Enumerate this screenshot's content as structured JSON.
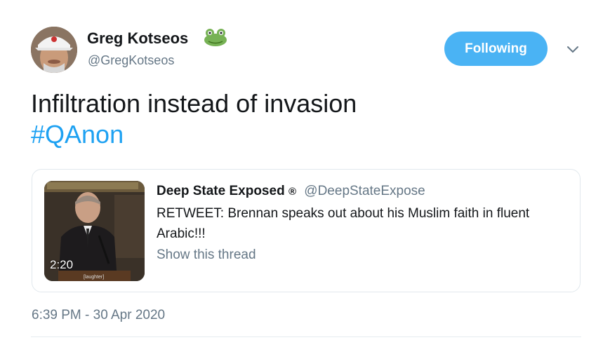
{
  "author": {
    "name": "Greg Kotseos",
    "handle": "@GregKotseos",
    "emoji_icon": "frog-icon"
  },
  "follow_button": {
    "label": "Following",
    "color": "#4ab3f4"
  },
  "menu": {
    "icon": "chevron-down-icon"
  },
  "tweet": {
    "text": "Infiltration instead of invasion",
    "hashtag": "#QAnon",
    "hashtag_color": "#1da1f2"
  },
  "quoted_tweet": {
    "name": "Deep State Exposed",
    "verified_mark": "®",
    "handle": "@DeepStateExpose",
    "text": "RETWEET: Brennan speaks out about his Muslim faith in fluent Arabic!!!",
    "show_thread": "Show this thread",
    "video": {
      "duration": "2:20",
      "caption": "[laughter]"
    }
  },
  "timestamp": "6:39 PM - 30 Apr 2020"
}
